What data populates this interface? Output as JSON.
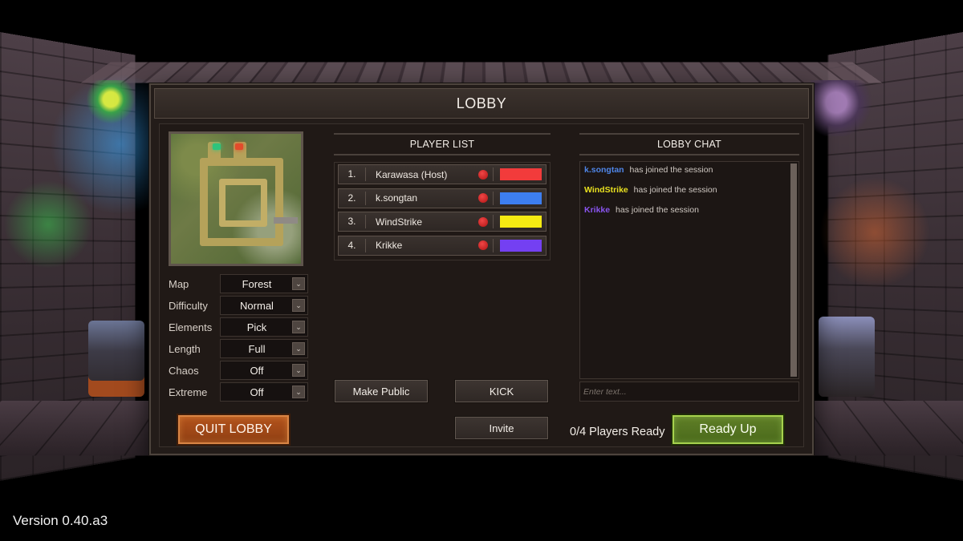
{
  "lobby": {
    "title": "LOBBY"
  },
  "map_preview": {
    "name": "Forest minimap"
  },
  "settings": [
    {
      "label": "Map",
      "value": "Forest"
    },
    {
      "label": "Difficulty",
      "value": "Normal"
    },
    {
      "label": "Elements",
      "value": "Pick"
    },
    {
      "label": "Length",
      "value": "Full"
    },
    {
      "label": "Chaos",
      "value": "Off"
    },
    {
      "label": "Extreme",
      "value": "Off"
    }
  ],
  "player_list": {
    "title": "PLAYER LIST",
    "players": [
      {
        "number": "1.",
        "name": "Karawasa (Host)",
        "ready": false,
        "color": "#f23b3b"
      },
      {
        "number": "2.",
        "name": "k.songtan",
        "ready": false,
        "color": "#3d7ef0"
      },
      {
        "number": "3.",
        "name": "WindStrike",
        "ready": false,
        "color": "#f5ea12"
      },
      {
        "number": "4.",
        "name": "Krikke",
        "ready": false,
        "color": "#7440f2"
      }
    ]
  },
  "buttons": {
    "make_public": "Make Public",
    "kick": "KICK",
    "invite": "Invite",
    "quit_lobby": "QUIT LOBBY",
    "ready_up": "Ready Up"
  },
  "chat": {
    "title": "LOBBY CHAT",
    "messages": [
      {
        "user": "k.songtan",
        "text": "has joined the session",
        "color": "#4f86e8"
      },
      {
        "user": "WindStrike",
        "text": "has joined the session",
        "color": "#e8e020"
      },
      {
        "user": "Krikke",
        "text": "has joined the session",
        "color": "#8a55f0"
      }
    ],
    "input_placeholder": "Enter text..."
  },
  "ready_status": "0/4 Players Ready",
  "version": "Version 0.40.a3",
  "colors": {
    "ready_indicator": "#d42020",
    "quit_accent": "#b3531c",
    "ready_accent": "#a6d24d"
  }
}
